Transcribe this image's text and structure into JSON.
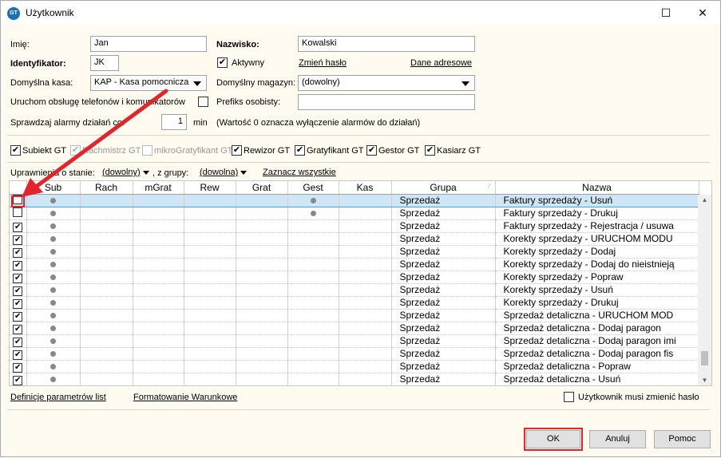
{
  "window": {
    "title": "Użytkownik",
    "icon": "gt-app-icon",
    "minimize_glyph": "—",
    "maximize_glyph": "☐",
    "close_glyph": "✕"
  },
  "form": {
    "imie_label": "Imię:",
    "imie_value": "Jan",
    "nazwisko_label": "Nazwisko:",
    "nazwisko_value": "Kowalski",
    "identyfikator_label": "Identyfikator:",
    "identyfikator_value": "JK",
    "aktywny_label": "Aktywny",
    "aktywny_checked": true,
    "zmien_haslo": "Zmień hasło",
    "dane_adresowe": "Dane adresowe",
    "kasa_label": "Domyślna kasa:",
    "kasa_value": "KAP - Kasa pomocnicza",
    "magazyn_label": "Domyślny magazyn:",
    "magazyn_value": "(dowolny)",
    "telefony_label": "Uruchom obsługę telefonów i komunikatorów",
    "prefiks_label": "Prefiks osobisty:",
    "prefiks_value": "",
    "alarmy_label": "Sprawdzaj alarmy działań co:",
    "alarmy_value": "1",
    "alarmy_unit": "min",
    "alarmy_note": "(Wartość 0 oznacza wyłączenie alarmów do działań)"
  },
  "roles": [
    {
      "label": "Subiekt GT",
      "checked": true,
      "enabled": true
    },
    {
      "label": "Rachmistrz GT",
      "checked": true,
      "enabled": false
    },
    {
      "label": "mikroGratyfikant GT",
      "checked": false,
      "enabled": false
    },
    {
      "label": "Rewizor GT",
      "checked": true,
      "enabled": true
    },
    {
      "label": "Gratyfikant GT",
      "checked": true,
      "enabled": true
    },
    {
      "label": "Gestor GT",
      "checked": true,
      "enabled": true
    },
    {
      "label": "Kasiarz GT",
      "checked": true,
      "enabled": true
    }
  ],
  "filter": {
    "prefix": "Uprawnienia o stanie:",
    "stan": "(dowolny)",
    "grupy_label": ", z grupy:",
    "grupa": "(dowolna)",
    "zaznacz": "Zaznacz wszystkie"
  },
  "grid": {
    "columns": [
      "",
      "Sub",
      "Rach",
      "mGrat",
      "Rew",
      "Grat",
      "Gest",
      "Kas",
      "Grupa",
      "Nazwa"
    ],
    "rows": [
      {
        "checked": false,
        "sub": true,
        "gest": true,
        "grupa": "Sprzedaż",
        "nazwa": "Faktury sprzedaży - Usuń",
        "selected": true
      },
      {
        "checked": false,
        "sub": true,
        "gest": true,
        "grupa": "Sprzedaż",
        "nazwa": "Faktury sprzedaży - Drukuj"
      },
      {
        "checked": true,
        "sub": true,
        "gest": false,
        "grupa": "Sprzedaż",
        "nazwa": "Faktury sprzedaży - Rejestracja / usuwa"
      },
      {
        "checked": true,
        "sub": true,
        "gest": false,
        "grupa": "Sprzedaż",
        "nazwa": "Korekty sprzedaży - URUCHOM MODU"
      },
      {
        "checked": true,
        "sub": true,
        "gest": false,
        "grupa": "Sprzedaż",
        "nazwa": "Korekty sprzedaży - Dodaj"
      },
      {
        "checked": true,
        "sub": true,
        "gest": false,
        "grupa": "Sprzedaż",
        "nazwa": "Korekty sprzedaży - Dodaj do nieistnieją"
      },
      {
        "checked": true,
        "sub": true,
        "gest": false,
        "grupa": "Sprzedaż",
        "nazwa": "Korekty sprzedaży - Popraw"
      },
      {
        "checked": true,
        "sub": true,
        "gest": false,
        "grupa": "Sprzedaż",
        "nazwa": "Korekty sprzedaży - Usuń"
      },
      {
        "checked": true,
        "sub": true,
        "gest": false,
        "grupa": "Sprzedaż",
        "nazwa": "Korekty sprzedaży - Drukuj"
      },
      {
        "checked": true,
        "sub": true,
        "gest": false,
        "grupa": "Sprzedaż",
        "nazwa": "Sprzedaż detaliczna - URUCHOM MOD"
      },
      {
        "checked": true,
        "sub": true,
        "gest": false,
        "grupa": "Sprzedaż",
        "nazwa": "Sprzedaż detaliczna - Dodaj paragon"
      },
      {
        "checked": true,
        "sub": true,
        "gest": false,
        "grupa": "Sprzedaż",
        "nazwa": "Sprzedaż detaliczna - Dodaj paragon imi"
      },
      {
        "checked": true,
        "sub": true,
        "gest": false,
        "grupa": "Sprzedaż",
        "nazwa": "Sprzedaż detaliczna - Dodaj paragon fis"
      },
      {
        "checked": true,
        "sub": true,
        "gest": false,
        "grupa": "Sprzedaż",
        "nazwa": "Sprzedaż detaliczna - Popraw"
      },
      {
        "checked": true,
        "sub": true,
        "gest": false,
        "grupa": "Sprzedaż",
        "nazwa": "Sprzedaż detaliczna - Usuń"
      }
    ]
  },
  "bottom": {
    "definicje": "Definicje parametrów list",
    "formatowanie": "Formatowanie Warunkowe",
    "musi_zmienic": "Użytkownik musi zmienić hasło",
    "ok": "OK",
    "anuluj": "Anuluj",
    "pomoc": "Pomoc"
  },
  "annotation_color": "#e0262b"
}
